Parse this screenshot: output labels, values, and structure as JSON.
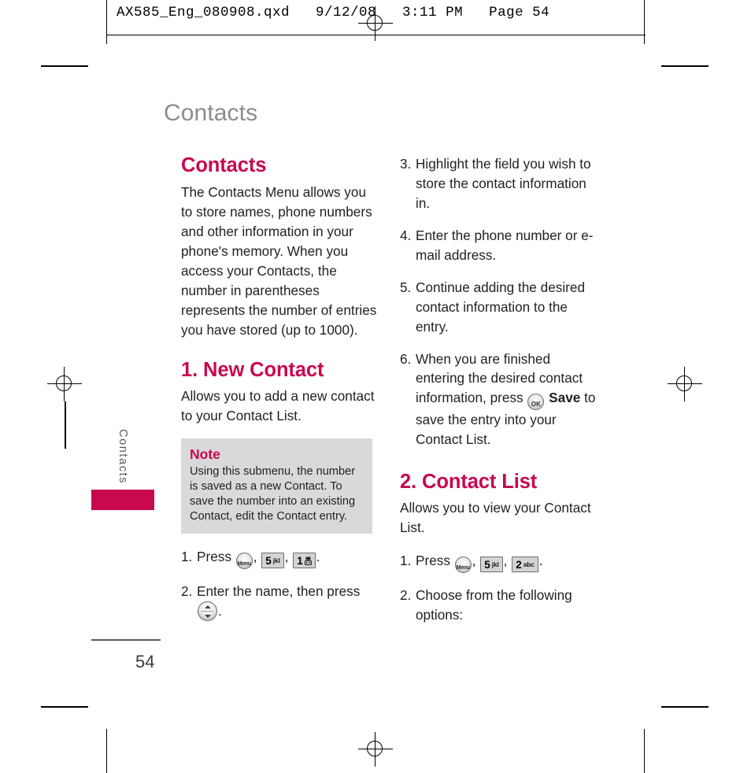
{
  "proof": {
    "header": "AX585_Eng_080908.qxd   9/12/08   3:11 PM   Page 54"
  },
  "page": {
    "title": "Contacts",
    "side_tab_label": "Contacts",
    "page_number": "54",
    "accent_color": "#c8084f",
    "title_color": "#8c8c8c",
    "note_bg_color": "#d9d9d9"
  },
  "left_column": {
    "section_heading": "Contacts",
    "intro": "The Contacts Menu allows you to store names, phone numbers and other information in your phone's memory. When you access your Contacts, the number in parentheses represents the number of entries you have stored (up to 1000).",
    "new_contact": {
      "heading": "1. New Contact",
      "body": "Allows you to add a new contact to your Contact List."
    },
    "note": {
      "title": "Note",
      "body": "Using this submenu, the number is saved as a new Contact. To save the number into an existing Contact, edit the Contact entry."
    },
    "steps": [
      {
        "num": "1.",
        "pre": "Press",
        "keys": [
          {
            "icon": "menu-key-icon",
            "label": "Menu"
          },
          {
            "icon": "key-5-icon",
            "digit": "5",
            "letters": "jkl"
          },
          {
            "icon": "key-1-voicemail-icon",
            "digit": "1",
            "letters": ""
          }
        ],
        "post": "."
      },
      {
        "num": "2.",
        "pre": "Enter the name, then press",
        "keys": [
          {
            "icon": "nav-updown-key-icon",
            "label": ""
          }
        ],
        "post": "."
      }
    ]
  },
  "right_column": {
    "steps_continued": [
      {
        "num": "3.",
        "text": "Highlight the field you wish to store the contact information in."
      },
      {
        "num": "4.",
        "text": "Enter the phone number or e-mail address."
      },
      {
        "num": "5.",
        "text": "Continue adding the desired contact information to the entry."
      }
    ],
    "step_six": {
      "num": "6.",
      "part1": "When you are finished entering the desired contact information, press",
      "ok_key_label": "OK",
      "save_label": "Save",
      "part2": "to save the entry into your Contact List."
    },
    "contact_list": {
      "heading": "2. Contact List",
      "body": "Allows you to view your Contact List."
    },
    "steps": [
      {
        "num": "1.",
        "pre": "Press",
        "keys": [
          {
            "icon": "menu-key-icon",
            "label": "Menu"
          },
          {
            "icon": "key-5-icon",
            "digit": "5",
            "letters": "jkl"
          },
          {
            "icon": "key-2-icon",
            "digit": "2",
            "letters": "abc"
          }
        ],
        "post": "."
      },
      {
        "num": "2.",
        "pre": "Choose from the following options:",
        "keys": [],
        "post": ""
      }
    ]
  }
}
